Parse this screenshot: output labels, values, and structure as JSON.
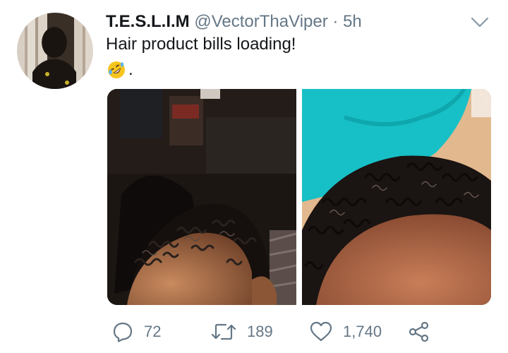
{
  "tweet": {
    "display_name": "T.E.S.L.I.M",
    "handle": "@VectorThaViper",
    "separator": "·",
    "time": "5h",
    "text": "Hair product bills loading!",
    "emoji_name": "rolling-on-floor-laughing-icon",
    "emoji_suffix": "."
  },
  "actions": {
    "replies": "72",
    "retweets": "189",
    "likes": "1,740"
  },
  "colors": {
    "text": "#14171a",
    "secondary": "#657786",
    "background": "#ffffff"
  }
}
